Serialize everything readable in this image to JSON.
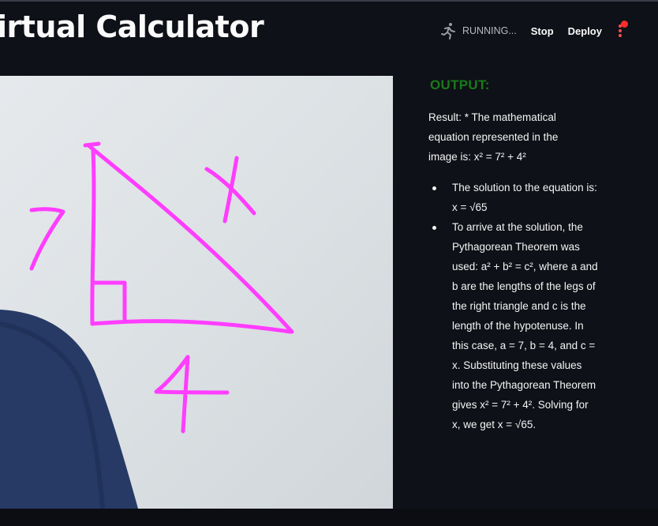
{
  "header": {
    "title": "irtual Calculator",
    "status_text": "RUNNING...",
    "stop_label": "Stop",
    "deploy_label": "Deploy",
    "icons": [
      "running-person-icon",
      "main-menu-icon"
    ]
  },
  "webcam": {
    "annotations": [
      "7",
      "x",
      "4"
    ],
    "stroke_color": "#ff3dff"
  },
  "output": {
    "heading": "OUTPUT:",
    "heading_color": "#1a7a1a",
    "intro": "Result: * The mathematical equation represented in the image is: x² = 7² + 4²",
    "bullets": [
      "The solution to the equation is: x = √65",
      "To arrive at the solution, the Pythagorean Theorem was used: a² + b² = c², where a and b are the lengths of the legs of the right triangle and c is the length of the hypotenuse. In this case, a = 7, b = 4, and c = x. Substituting these values into the Pythagorean Theorem gives x² = 7² + 4². Solving for x, we get x = √65."
    ]
  },
  "colors": {
    "background": "#0e1117",
    "status_red": "#ff4b4b"
  }
}
